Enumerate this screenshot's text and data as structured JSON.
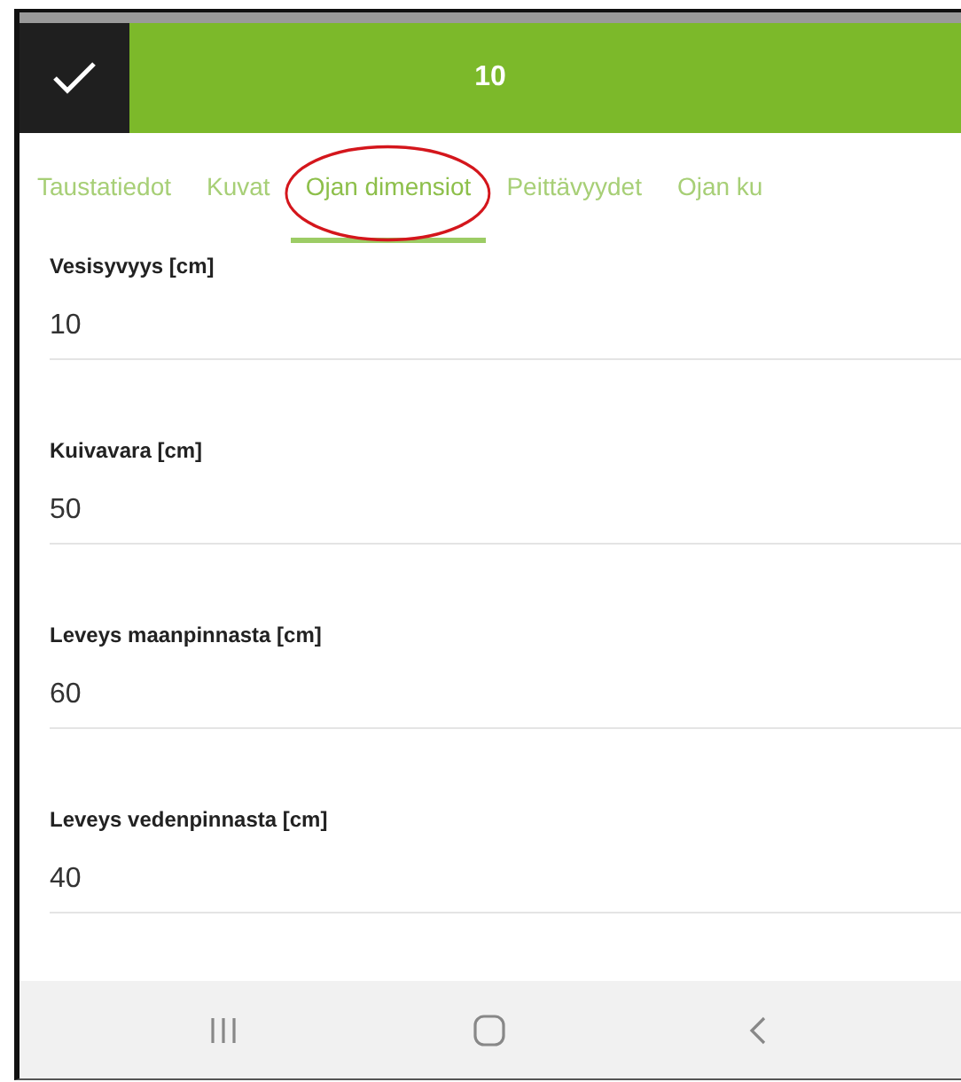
{
  "header": {
    "title": "10",
    "confirm": {
      "kind": "check"
    }
  },
  "tabs": [
    {
      "label": "Taustatiedot",
      "selected": false,
      "circled": false
    },
    {
      "label": "Kuvat",
      "selected": false,
      "circled": false
    },
    {
      "label": "Ojan dimensiot",
      "selected": true,
      "circled": true
    },
    {
      "label": "Peittävyydet",
      "selected": false,
      "circled": false
    },
    {
      "label": "Ojan ku",
      "selected": false,
      "circled": false
    }
  ],
  "fields": [
    {
      "label": "Vesisyvyys [cm]",
      "value": "10"
    },
    {
      "label": "Kuivavara [cm]",
      "value": "50"
    },
    {
      "label": "Leveys maanpinnasta [cm]",
      "value": "60"
    },
    {
      "label": "Leveys vedenpinnasta [cm]",
      "value": "40"
    }
  ],
  "nav_bar": [
    {
      "kind": "recent"
    },
    {
      "kind": "home"
    },
    {
      "kind": "back"
    }
  ]
}
